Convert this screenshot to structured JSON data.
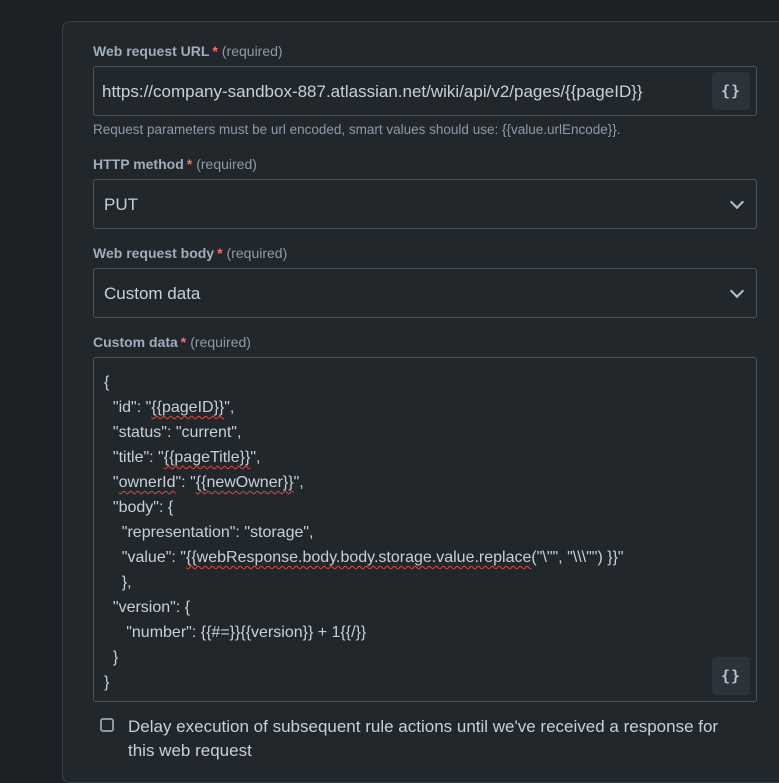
{
  "url_field": {
    "label": "Web request URL",
    "star": "*",
    "required": "(required)",
    "value": "https://company-sandbox-887.atlassian.net/wiki/api/v2/pages/{{pageID}}",
    "helper": "Request parameters must be url encoded, smart values should use: {{value.urlEncode}}.",
    "smart_value_button": "{}"
  },
  "method_field": {
    "label": "HTTP method",
    "star": "*",
    "required": "(required)",
    "value": "PUT"
  },
  "body_field": {
    "label": "Web request body",
    "star": "*",
    "required": "(required)",
    "value": "Custom data"
  },
  "custom_data": {
    "label": "Custom data",
    "star": "*",
    "required": "(required)",
    "smart_value_button": "{}",
    "lines": [
      "{",
      "  \"id\": \"{{pageID}}\",",
      "  \"status\": \"current\",",
      "  \"title\": \"{{pageTitle}}\",",
      "  \"ownerId\": \"{{newOwner}}\",",
      "  \"body\": {",
      "    \"representation\": \"storage\",",
      "    \"value\": \"{{webResponse.body.body.storage.value.replace(\"\\\"\", \"\\\\\\\"\") }}\"",
      "    },",
      "  \"version\": {",
      "     \"number\": {{#=}}{{version}} + 1{{/}}",
      "  }",
      "}"
    ]
  },
  "delay_checkbox": {
    "label": "Delay execution of subsequent rule actions until we've received a response for this web request",
    "checked": false
  }
}
